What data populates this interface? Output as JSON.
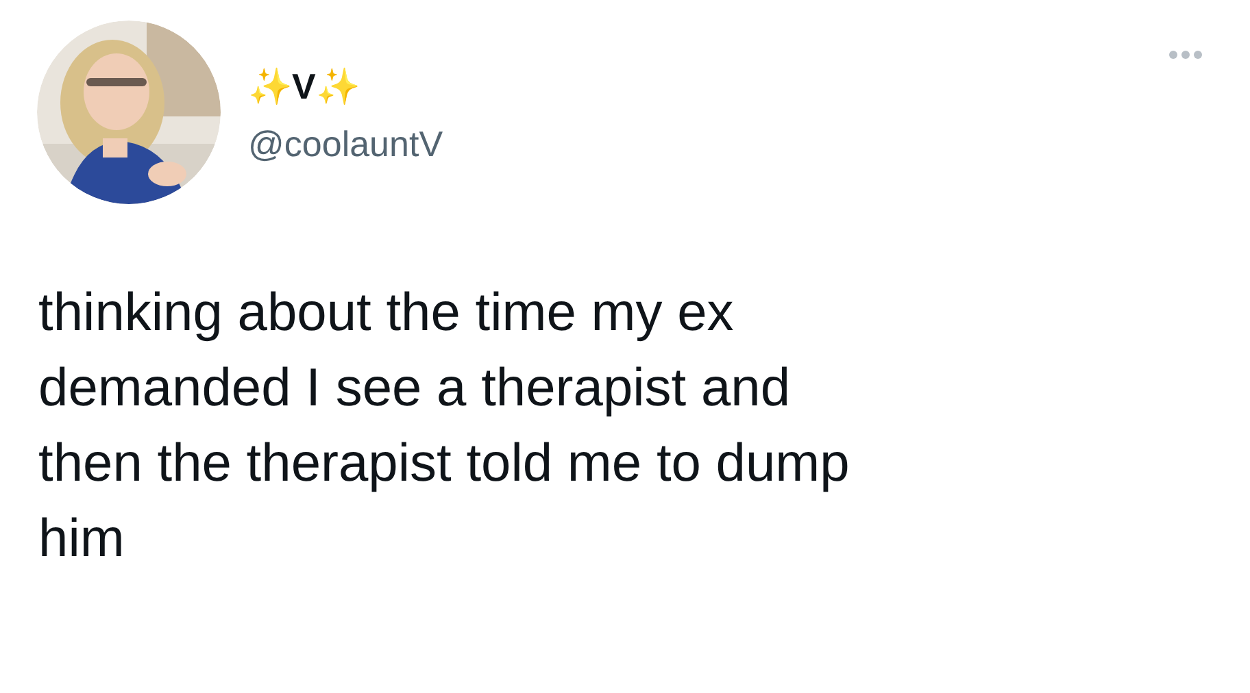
{
  "tweet": {
    "author": {
      "display_name": "✨V✨",
      "handle": "@coolauntV"
    },
    "text": "thinking about the time my ex\ndemanded I see a therapist and\nthen the therapist told me to dump\nhim"
  }
}
